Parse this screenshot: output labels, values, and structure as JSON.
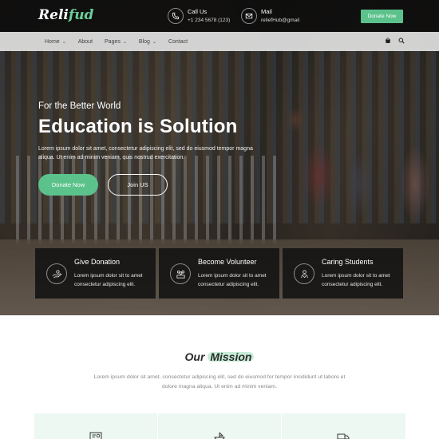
{
  "header": {
    "logo": {
      "part1": "Reli",
      "part2": "fud"
    },
    "call": {
      "label": "Call Us",
      "value": "+1 234 5678 (123)"
    },
    "mail": {
      "label": "Mail",
      "value": "reliefHub@gmail"
    },
    "donate_button": "Donate Now"
  },
  "nav": {
    "items": [
      {
        "label": "Home",
        "has_dropdown": true
      },
      {
        "label": "About",
        "has_dropdown": false
      },
      {
        "label": "Pages",
        "has_dropdown": true
      },
      {
        "label": "Blog",
        "has_dropdown": true
      },
      {
        "label": "Contact",
        "has_dropdown": false
      }
    ],
    "chevron": "⌄",
    "icons": [
      "cart-icon",
      "search-icon"
    ]
  },
  "hero": {
    "kicker": "For the Better World",
    "headline": "Education is Solution",
    "text": "Lorem ipsum dolor sit amet, consectetur adipiscing elit, sed do eiusmod tempor magna aliqua. Ut enim ad minim veniam, quis nostrud exercitation.",
    "primary_button": "Donate Now",
    "secondary_button": "Join US"
  },
  "features": [
    {
      "title": "Give Donation",
      "text": "Lorem ipsum dolor sit to amet consectetur adipiscing elit.",
      "icon": "donation-hands-icon"
    },
    {
      "title": "Become Volunteer",
      "text": "Lorem ipsum dolor sit to amet consectetur adipiscing elit.",
      "icon": "volunteer-team-icon"
    },
    {
      "title": "Caring Students",
      "text": "Lorem ipsum dolor sit to amet consectetur adipiscing elit.",
      "icon": "caring-person-icon"
    }
  ],
  "mission": {
    "title_part1": "Our",
    "title_part2": "Mission",
    "text": "Lorem ipsum dolor sit amet, consectetur adipiscing elit, sed do eiusmod for tempor incididunt ut labore et dolore magna aliqua. Ut enim ad minim veniam.",
    "cards": [
      {
        "icon": "certificate-icon"
      },
      {
        "icon": "boat-icon"
      },
      {
        "icon": "truck-icon"
      }
    ]
  },
  "colors": {
    "accent": "#5cc28c",
    "mission_highlight": "#c7ecd7",
    "topbar": "#0c0c0c",
    "card_bg": "#121212"
  }
}
